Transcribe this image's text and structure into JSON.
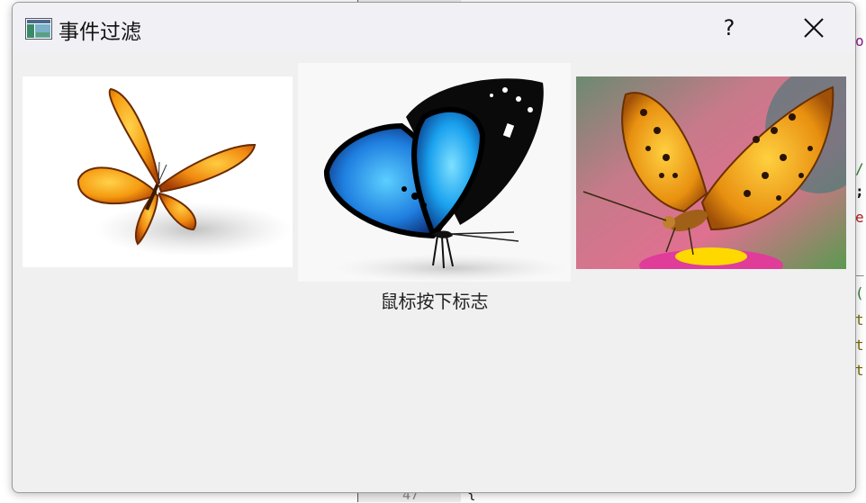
{
  "window": {
    "title": "事件过滤",
    "help_label": "?",
    "close_icon": "close-icon",
    "app_icon": "window-app-icon"
  },
  "images": [
    {
      "name": "orange-butterfly-image",
      "subject": "orange butterfly on white"
    },
    {
      "name": "blue-butterfly-image",
      "subject": "blue and black butterfly on white"
    },
    {
      "name": "fritillary-butterfly-image",
      "subject": "orange spotted butterfly on pink flower"
    }
  ],
  "status": {
    "text": "鼠标按下标志"
  },
  "background": {
    "line_number": "47",
    "brace": "{",
    "code_fragments": [
      {
        "text": "o",
        "color": "#8b1a8b"
      },
      {
        "text": "/",
        "color": "#2e7d32"
      },
      {
        "text": ";",
        "color": "#111111"
      },
      {
        "text": "e",
        "color": "#b71c1c"
      },
      {
        "text": "_",
        "color": "#444444"
      },
      {
        "text": "(",
        "color": "#2e7d32"
      },
      {
        "text": "t",
        "color": "#7a6a00"
      },
      {
        "text": "t",
        "color": "#7a6a00"
      },
      {
        "text": "t",
        "color": "#7a6a00"
      }
    ]
  }
}
